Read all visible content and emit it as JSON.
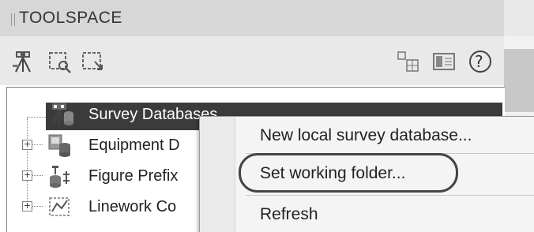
{
  "panel": {
    "title": "TOOLSPACE"
  },
  "toolbar": {
    "left_icons": [
      "survey-tripod-icon",
      "zoom-window-icon",
      "pan-window-icon"
    ],
    "right_icons": [
      "network-grid-icon",
      "panel-list-icon",
      "help-icon"
    ],
    "help_glyph": "?"
  },
  "tree": {
    "items": [
      {
        "label": "Survey Databases",
        "icon": "survey-database-icon",
        "selected": true
      },
      {
        "label": "Equipment D",
        "icon": "equipment-database-icon",
        "selected": false
      },
      {
        "label": "Figure Prefix",
        "icon": "figure-prefix-icon",
        "selected": false
      },
      {
        "label": "Linework Co",
        "icon": "linework-code-icon",
        "selected": false
      }
    ]
  },
  "context_menu": {
    "items": [
      {
        "label": "New local survey database..."
      },
      {
        "label": "Set working folder...",
        "highlighted": true
      },
      {
        "label": "Refresh"
      }
    ]
  }
}
